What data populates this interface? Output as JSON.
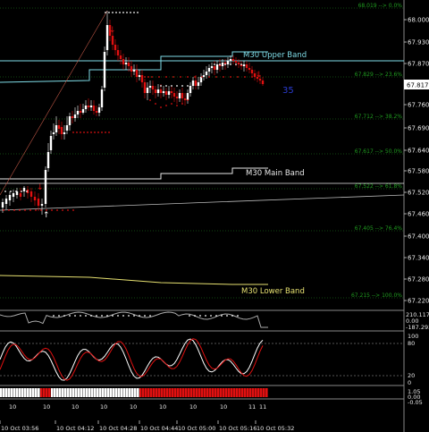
{
  "price_axis": {
    "labels": [
      "68.000",
      "67.930",
      "67.870",
      "67.817",
      "67.760",
      "67.690",
      "67.640",
      "67.580",
      "67.520",
      "67.460",
      "67.400",
      "67.340",
      "67.280",
      "67.220"
    ],
    "current_price": "67.817",
    "current_price_color": "#ffffff"
  },
  "fib_levels": [
    {
      "label": "68.019 --> 0.0%"
    },
    {
      "label": "67.829 --> 23.6%"
    },
    {
      "label": "67.712 --> 38.2%"
    },
    {
      "label": "67.617 --> 50.0%"
    },
    {
      "label": "67.522 --> 61.8%"
    },
    {
      "label": "67.405 --> 76.4%"
    },
    {
      "label": "67.215 --> 100.0%"
    }
  ],
  "bands": {
    "upper": {
      "label": "M30 Upper Band",
      "color": "#7fdde8"
    },
    "main": {
      "label": "M30 Main Band",
      "color": "#e8e8e8"
    },
    "lower": {
      "label": "M30 Lower Band",
      "color": "#e6e070"
    }
  },
  "countdown": "35",
  "indicator1": {
    "labels": [
      "210.1173",
      "0.00",
      "-187.2937"
    ]
  },
  "indicator2": {
    "labels": [
      "100",
      "80",
      "20",
      "0"
    ]
  },
  "indicator3": {
    "labels": [
      "1.05",
      "0.00",
      "-0.05"
    ]
  },
  "time_axis": {
    "day_marks": [
      "10",
      "10",
      "10",
      "10",
      "10",
      "10",
      "10",
      "10",
      "11",
      "11"
    ],
    "labels": [
      "10 Oct 03:56",
      "10 Oct 04:12",
      "10 Oct 04:28",
      "10 Oct 04:44",
      "10 Oct 05:00",
      "10 Oct 05:16",
      "10 Oct 05:32"
    ]
  },
  "colors": {
    "bull": "#ffffff",
    "bear": "#e01010",
    "fib": "#1f9a1f",
    "stoch_main": "#ffffff",
    "stoch_signal": "#e01010"
  }
}
